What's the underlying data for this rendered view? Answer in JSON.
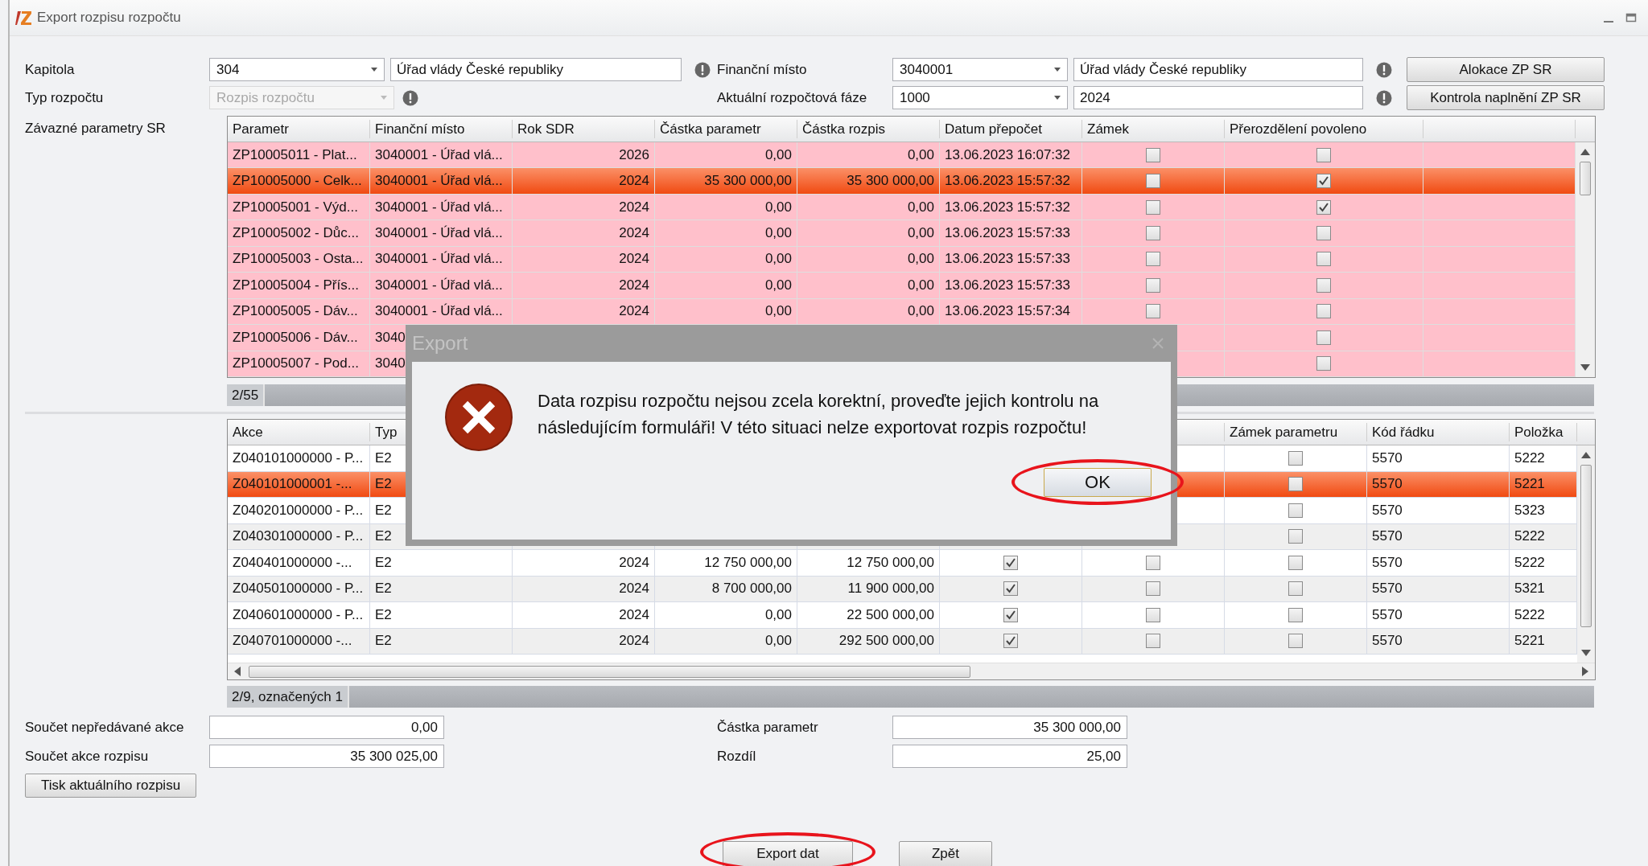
{
  "window": {
    "title": "Export rozpisu rozpočtu"
  },
  "kapitola": {
    "label": "Kapitola",
    "code": "304",
    "name": "Úřad vlády České republiky"
  },
  "typ_rozpoctu": {
    "label": "Typ rozpočtu",
    "value": "Rozpis rozpočtu",
    "disabled": true
  },
  "financni_misto": {
    "label": "Finanční místo",
    "code": "3040001",
    "name": "Úřad vlády České republiky"
  },
  "faze": {
    "label": "Aktuální rozpočtová fáze",
    "code": "1000",
    "value": "2024"
  },
  "side_buttons": [
    "Alokace ZP SR",
    "Kontrola naplnění ZP SR"
  ],
  "parameters_table": {
    "label": "Závazné parametry SR",
    "headers": {
      "parametr": "Parametr",
      "financni_misto": "Finanční místo",
      "rok": "Rok SDR",
      "castka_parametr": "Částka parametr",
      "castka_rozpis": "Částka rozpis",
      "datum": "Datum přepočet",
      "zamek": "Zámek",
      "prerozdeleni": "Přerozdělení povoleno"
    },
    "rows": [
      {
        "selected": false,
        "parametr": "ZP10005011 - Plat...",
        "financni_misto": "3040001 - Úřad vlá...",
        "rok": "2026",
        "castka_parametr": "0,00",
        "castka_rozpis": "0,00",
        "datum": "13.06.2023 16:07:32",
        "zamek": false,
        "prerozdeleni": false
      },
      {
        "selected": true,
        "parametr": "ZP10005000 - Celk...",
        "financni_misto": "3040001 - Úřad vlá...",
        "rok": "2024",
        "castka_parametr": "35 300 000,00",
        "castka_rozpis": "35 300 000,00",
        "datum": "13.06.2023 15:57:32",
        "zamek": false,
        "prerozdeleni": true
      },
      {
        "selected": false,
        "parametr": "ZP10005001 - Výd...",
        "financni_misto": "3040001 - Úřad vlá...",
        "rok": "2024",
        "castka_parametr": "0,00",
        "castka_rozpis": "0,00",
        "datum": "13.06.2023 15:57:32",
        "zamek": false,
        "prerozdeleni": true
      },
      {
        "selected": false,
        "parametr": "ZP10005002 - Důc...",
        "financni_misto": "3040001 - Úřad vlá...",
        "rok": "2024",
        "castka_parametr": "0,00",
        "castka_rozpis": "0,00",
        "datum": "13.06.2023 15:57:33",
        "zamek": false,
        "prerozdeleni": false
      },
      {
        "selected": false,
        "parametr": "ZP10005003 - Osta...",
        "financni_misto": "3040001 - Úřad vlá...",
        "rok": "2024",
        "castka_parametr": "0,00",
        "castka_rozpis": "0,00",
        "datum": "13.06.2023 15:57:33",
        "zamek": false,
        "prerozdeleni": false
      },
      {
        "selected": false,
        "parametr": "ZP10005004 - Přís...",
        "financni_misto": "3040001 - Úřad vlá...",
        "rok": "2024",
        "castka_parametr": "0,00",
        "castka_rozpis": "0,00",
        "datum": "13.06.2023 15:57:33",
        "zamek": false,
        "prerozdeleni": false
      },
      {
        "selected": false,
        "parametr": "ZP10005005 - Dáv...",
        "financni_misto": "3040001 - Úřad vlá...",
        "rok": "2024",
        "castka_parametr": "0,00",
        "castka_rozpis": "0,00",
        "datum": "13.06.2023 15:57:34",
        "zamek": false,
        "prerozdeleni": false
      },
      {
        "selected": false,
        "parametr": "ZP10005006 - Dáv...",
        "financni_misto": "3040",
        "prerozdeleni": false
      },
      {
        "selected": false,
        "parametr": "ZP10005007 - Pod...",
        "financni_misto": "3040",
        "prerozdeleni": false
      }
    ],
    "status": "2/55"
  },
  "actions_table": {
    "headers": {
      "akce": "Akce",
      "typ": "Typ",
      "zamek_parametru": "Zámek parametru",
      "kod_radku": "Kód řádku",
      "polozka": "Položka"
    },
    "rows": [
      {
        "selected": false,
        "akce": "Z040101000000 - P...",
        "typ": "E2",
        "zamek_parametru": false,
        "kod_radku": "5570",
        "polozka": "5222"
      },
      {
        "selected": true,
        "akce": "Z040101000001 -...",
        "typ": "E2",
        "zamek_parametru": false,
        "kod_radku": "5570",
        "polozka": "5221"
      },
      {
        "selected": false,
        "akce": "Z040201000000 - P...",
        "typ": "E2",
        "zamek_parametru": false,
        "kod_radku": "5570",
        "polozka": "5323"
      },
      {
        "selected": false,
        "akce": "Z040301000000 - P...",
        "typ": "E2",
        "zamek_parametru": false,
        "kod_radku": "5570",
        "polozka": "5222"
      },
      {
        "selected": false,
        "akce": "Z040401000000 -...",
        "typ": "E2",
        "rok": "2024",
        "castka_1": "12 750 000,00",
        "castka_2": "12 750 000,00",
        "check_1": true,
        "check_2": false,
        "zamek_parametru": false,
        "kod_radku": "5570",
        "polozka": "5222"
      },
      {
        "selected": false,
        "akce": "Z040501000000 - P...",
        "typ": "E2",
        "rok": "2024",
        "castka_1": "8 700 000,00",
        "castka_2": "11 900 000,00",
        "check_1": true,
        "check_2": false,
        "zamek_parametru": false,
        "kod_radku": "5570",
        "polozka": "5321"
      },
      {
        "selected": false,
        "akce": "Z040601000000 - P...",
        "typ": "E2",
        "rok": "2024",
        "castka_1": "0,00",
        "castka_2": "22 500 000,00",
        "check_1": true,
        "check_2": false,
        "zamek_parametru": false,
        "kod_radku": "5570",
        "polozka": "5222"
      },
      {
        "selected": false,
        "akce": "Z040701000000 -...",
        "typ": "E2",
        "rok": "2024",
        "castka_1": "0,00",
        "castka_2": "292 500 000,00",
        "check_1": true,
        "check_2": false,
        "zamek_parametru": false,
        "kod_radku": "5570",
        "polozka": "5221"
      }
    ],
    "status": "2/9, označených 1"
  },
  "totals": [
    {
      "label": "Součet nepředávané akce",
      "value": "0,00"
    },
    {
      "label": "Součet akce rozpisu",
      "value": "35 300 025,00"
    },
    {
      "label": "Částka parametr",
      "value": "35 300 000,00"
    },
    {
      "label": "Rozdíl",
      "value": "25,00"
    }
  ],
  "print_button": "Tisk aktuálního rozpisu",
  "footer_buttons": [
    {
      "label": "Export dat",
      "highlighted": true
    },
    {
      "label": "Zpět",
      "highlighted": false
    }
  ],
  "dialog": {
    "title": "Export",
    "message": "Data rozpisu rozpočtu nejsou zcela korektní, proveďte jejich kontrolu na následujícím formuláři! V této situaci nelze exportovat rozpis rozpočtu!",
    "button": {
      "label": "OK",
      "highlighted": true
    }
  }
}
